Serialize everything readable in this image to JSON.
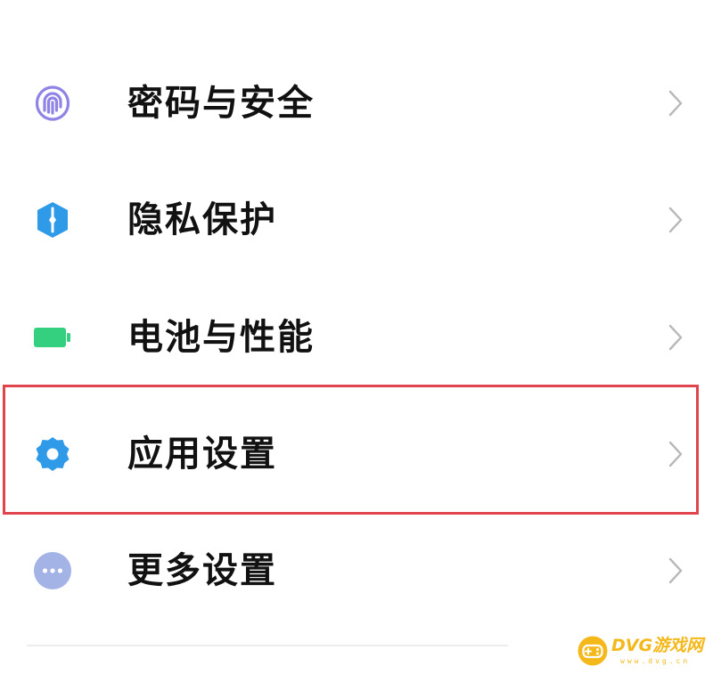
{
  "settings": {
    "items": [
      {
        "label": "密码与安全",
        "icon": "fingerprint-icon",
        "icon_color": "#8f84e6"
      },
      {
        "label": "隐私保护",
        "icon": "privacy-shield-icon",
        "icon_color": "#2f9be8"
      },
      {
        "label": "电池与性能",
        "icon": "battery-icon",
        "icon_color": "#35d07f"
      },
      {
        "label": "应用设置",
        "icon": "gear-icon",
        "icon_color": "#2f9be8"
      },
      {
        "label": "更多设置",
        "icon": "more-dots-icon",
        "icon_color": "#a3b3e6"
      }
    ],
    "highlighted_item": "应用设置",
    "highlight_color": "#e0454e",
    "chevron_icon": "chevron-right-icon"
  },
  "watermark": {
    "title": "DVG游戏网",
    "subtitle": "www.dvg.cn",
    "color": "#f4b81a",
    "icon": "gamepad-icon"
  }
}
